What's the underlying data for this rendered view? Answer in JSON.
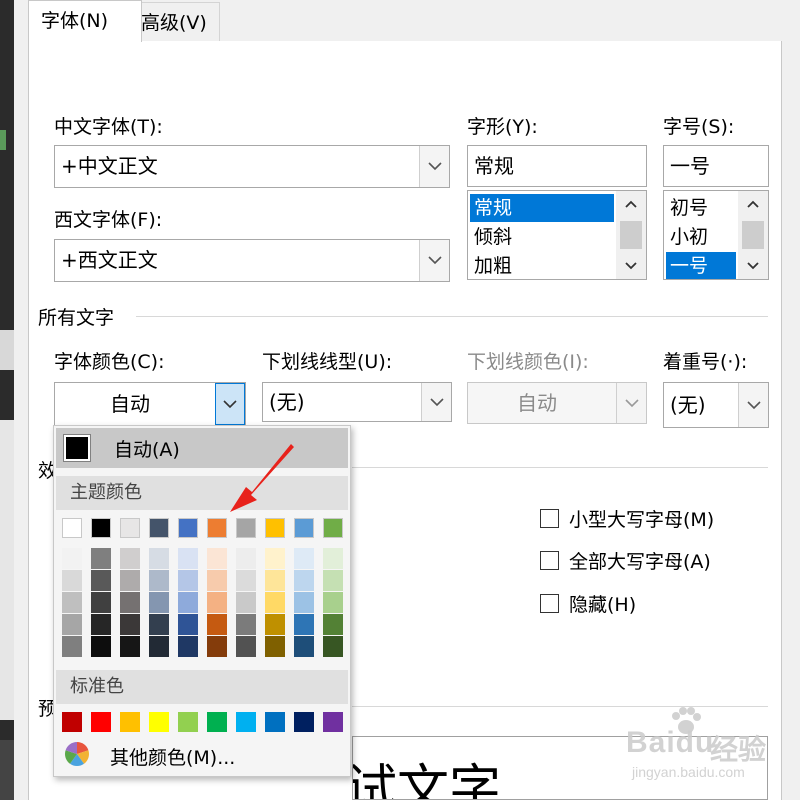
{
  "tabs": [
    {
      "label": "字体(N)"
    },
    {
      "label": "高级(V)"
    }
  ],
  "chinese_font": {
    "label": "中文字体(T):",
    "value": "+中文正文"
  },
  "western_font": {
    "label": "西文字体(F):",
    "value": "+西文正文"
  },
  "font_style": {
    "label": "字形(Y):",
    "value": "常规",
    "options": [
      "常规",
      "倾斜",
      "加粗"
    ],
    "selected": "常规"
  },
  "font_size": {
    "label": "字号(S):",
    "value": "一号",
    "options": [
      "初号",
      "小初",
      "一号"
    ],
    "selected": "一号"
  },
  "all_text": {
    "section_label": "所有文字",
    "font_color": {
      "label": "字体颜色(C):",
      "value": "自动"
    },
    "underline_style": {
      "label": "下划线线型(U):",
      "value": "(无)"
    },
    "underline_color": {
      "label": "下划线颜色(I):",
      "value": "自动"
    },
    "emphasis_mark": {
      "label": "着重号(·):",
      "value": "(无)"
    }
  },
  "effects": {
    "section_label": "效",
    "small_caps": "小型大写字母(M)",
    "all_caps": "全部大写字母(A)",
    "hidden": "隐藏(H)"
  },
  "preview": {
    "section_label": "预",
    "text": "测试文字"
  },
  "color_popup": {
    "auto_label": "自动(A)",
    "theme_header": "主题颜色",
    "theme_colors": [
      "#ffffff",
      "#000000",
      "#e7e6e6",
      "#44546a",
      "#4472c4",
      "#ed7d31",
      "#a5a5a5",
      "#ffc000",
      "#5b9bd5",
      "#70ad47"
    ],
    "theme_shades": [
      [
        "#f2f2f2",
        "#d9d9d9",
        "#bfbfbf",
        "#a6a6a6",
        "#7f7f7f"
      ],
      [
        "#7f7f7f",
        "#595959",
        "#404040",
        "#262626",
        "#0d0d0d"
      ],
      [
        "#d0cece",
        "#aeabab",
        "#757171",
        "#3b3838",
        "#161616"
      ],
      [
        "#d6dce4",
        "#adb9ca",
        "#8496b0",
        "#333f4f",
        "#222a35"
      ],
      [
        "#d9e2f3",
        "#b4c6e7",
        "#8eaadb",
        "#2f5496",
        "#1f3864"
      ],
      [
        "#fbe5d5",
        "#f7cbac",
        "#f4b183",
        "#c55a11",
        "#843c0b"
      ],
      [
        "#ededed",
        "#dbdbdb",
        "#c9c9c9",
        "#7b7b7b",
        "#525252"
      ],
      [
        "#fff2cc",
        "#fee599",
        "#ffd965",
        "#bf9000",
        "#7f6000"
      ],
      [
        "#deeaf6",
        "#bdd6ee",
        "#9cc2e5",
        "#2e75b5",
        "#1e4e79"
      ],
      [
        "#e2efd9",
        "#c5e0b3",
        "#a8d08d",
        "#538135",
        "#375623"
      ]
    ],
    "standard_header": "标准色",
    "standard_colors": [
      "#c00000",
      "#ff0000",
      "#ffc000",
      "#ffff00",
      "#92d050",
      "#00b050",
      "#00b0f0",
      "#0070c0",
      "#002060",
      "#7030a0"
    ],
    "more_label": "其他颜色(M)..."
  },
  "watermark": {
    "brand": "Baidu",
    "cn": "经验",
    "url": "jingyan.baidu.com"
  },
  "annotation_arrow_color": "#e8221b"
}
